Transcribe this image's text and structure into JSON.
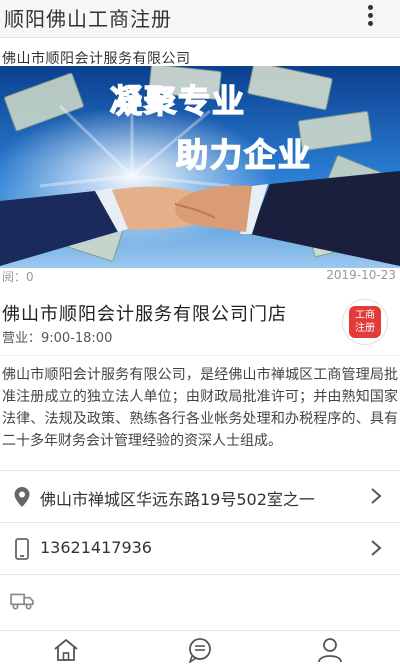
{
  "header": {
    "title": "顺阳佛山工商注册",
    "more_icon": "more-vertical-icon"
  },
  "banner": {
    "caption": "佛山市顺阳会计服务有限公司",
    "slogan_line1": "凝聚专业",
    "slogan_line2": "助力企业"
  },
  "post_meta": {
    "views": "阅：0",
    "date": "2019-10-23"
  },
  "store": {
    "name": "佛山市顺阳会计服务有限公司门店",
    "hours": "营业：9:00-18:00",
    "badge_line1": "工商",
    "badge_line2": "注册"
  },
  "description": "佛山市顺阳会计服务有限公司，是经佛山市禅城区工商管理局批准注册成立的独立法人单位；由财政局批准许可；并由熟知国家法律、法规及政策、熟练各行各业帐务处理和办税程序的、具有二十多年财务会计管理经验的资深人士组成。",
  "contact": {
    "address": "佛山市禅城区华远东路19号502室之一",
    "phone": "13621417936",
    "address_icon": "location-pin-icon",
    "phone_icon": "phone-icon",
    "delivery_icon": "delivery-truck-icon"
  },
  "bottom_nav": {
    "icons": [
      "home-icon",
      "message-icon",
      "user-icon"
    ]
  },
  "colors": {
    "accent_red": "#e23b3b",
    "banner_blue": "#1f5fb8",
    "slogan_red": "#e8222a"
  }
}
